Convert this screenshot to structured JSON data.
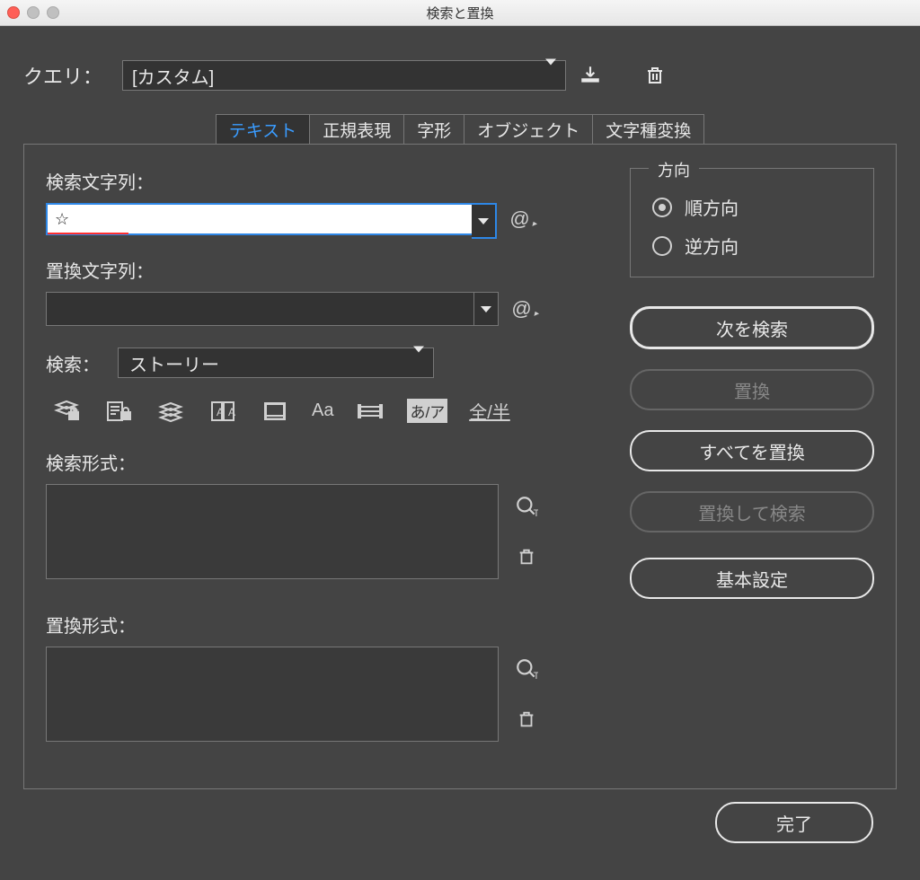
{
  "window": {
    "title": "検索と置換"
  },
  "query": {
    "label": "クエリ：",
    "value": "[カスタム]"
  },
  "tabs": {
    "text": "テキスト",
    "regex": "正規表現",
    "glyph": "字形",
    "object": "オブジェクト",
    "transliterate": "文字種変換"
  },
  "find": {
    "label": "検索文字列：",
    "value": "☆"
  },
  "change": {
    "label": "置換文字列：",
    "value": ""
  },
  "scope": {
    "label": "検索：",
    "value": "ストーリー"
  },
  "options": {
    "case": "Aa",
    "kana": "あ/ア",
    "width": "全/半"
  },
  "findFormat": {
    "label": "検索形式："
  },
  "changeFormat": {
    "label": "置換形式："
  },
  "direction": {
    "legend": "方向",
    "forward": "順方向",
    "backward": "逆方向"
  },
  "actions": {
    "findNext": "次を検索",
    "change": "置換",
    "changeAll": "すべてを置換",
    "changeFind": "置換して検索",
    "fewer": "基本設定",
    "done": "完了"
  },
  "underlineWidthPx": 90
}
